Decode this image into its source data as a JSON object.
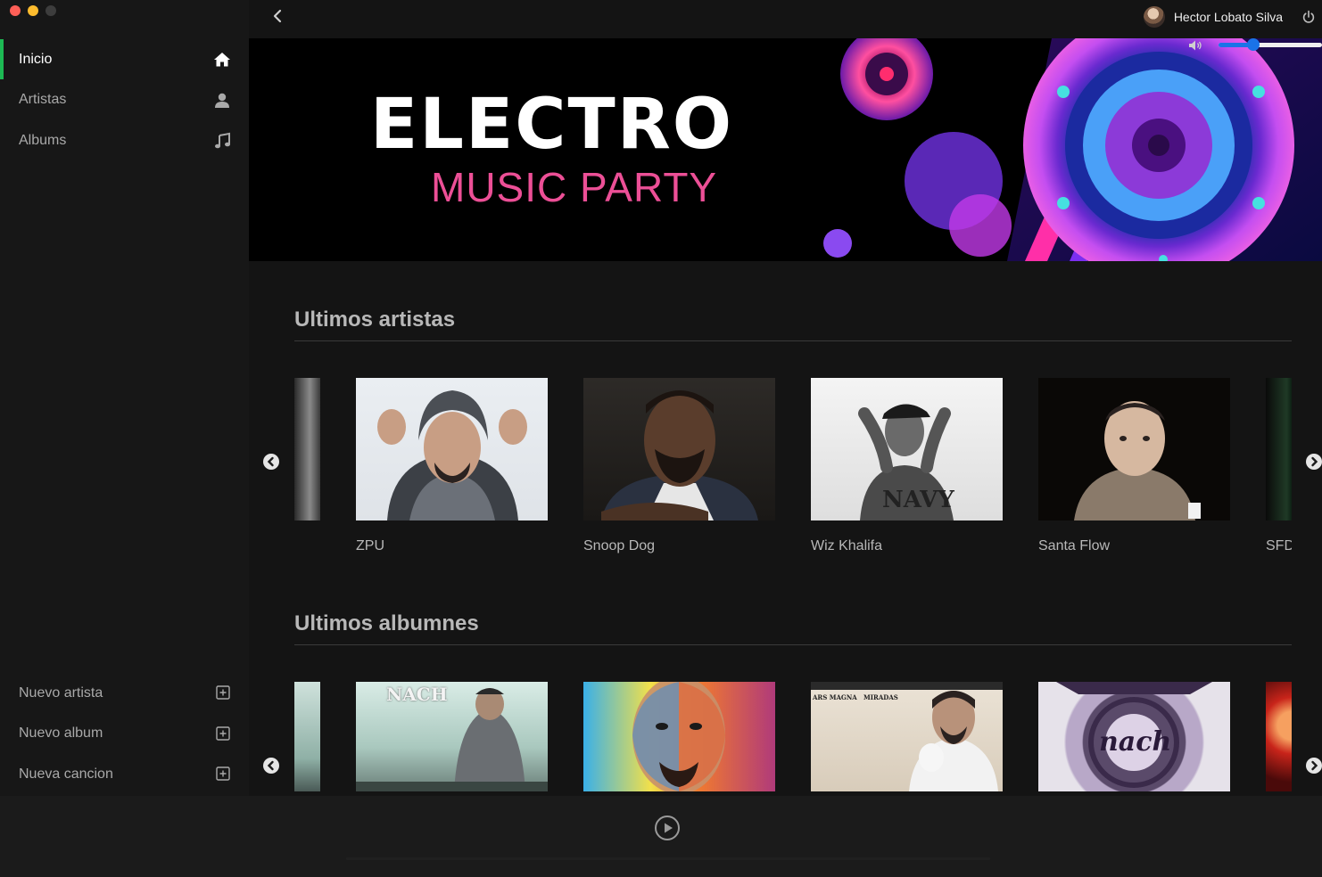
{
  "sidebar": {
    "items": [
      {
        "label": "Inicio",
        "icon": "home-icon",
        "active": true
      },
      {
        "label": "Artistas",
        "icon": "user-icon",
        "active": false
      },
      {
        "label": "Albums",
        "icon": "music-note-icon",
        "active": false
      }
    ],
    "actions": [
      {
        "label": "Nuevo artista",
        "icon": "plus-square-icon"
      },
      {
        "label": "Nuevo album",
        "icon": "plus-square-icon"
      },
      {
        "label": "Nueva cancion",
        "icon": "plus-square-icon"
      }
    ],
    "accent_color": "#1db954"
  },
  "header": {
    "user_name": "Hector Lobato Silva",
    "back_icon": "chevron-left-icon",
    "logout_icon": "power-icon"
  },
  "banner": {
    "title": "ELECTRO",
    "subtitle": "MUSIC PARTY",
    "subtitle_color": "#ec4f96"
  },
  "artists_section": {
    "title": "Ultimos artistas",
    "artists": [
      {
        "name": "ZPU"
      },
      {
        "name": "Snoop Dog"
      },
      {
        "name": "Wiz Khalifa"
      },
      {
        "name": "Santa Flow"
      },
      {
        "name": "SFD"
      }
    ]
  },
  "albums_section": {
    "title": "Ultimos albumnes",
    "albums": [
      {
        "cover_text": "NACH"
      },
      {
        "cover_text": ""
      },
      {
        "cover_text": "ARS MAGNA   MIRADAS"
      },
      {
        "cover_text": "nach"
      }
    ]
  },
  "player": {
    "play_icon": "play-circle-icon",
    "volume_icon": "volume-icon",
    "volume_level": 0.34,
    "volume_color": "#1a73e8"
  }
}
